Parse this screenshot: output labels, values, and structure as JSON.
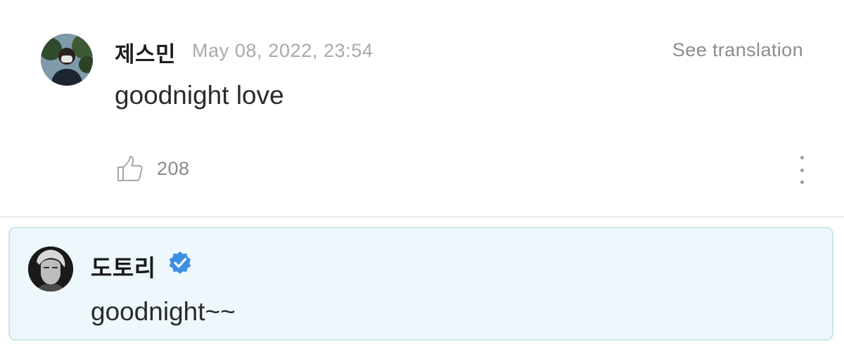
{
  "comment": {
    "author": "제스민",
    "timestamp": "May 08, 2022, 23:54",
    "translate_label": "See translation",
    "body": "goodnight love",
    "like_count": "208",
    "icons": {
      "avatar": "user-avatar",
      "like": "thumbs-up-icon",
      "more": "more-vertical-icon"
    }
  },
  "reply": {
    "author": "도토리",
    "verified": true,
    "body": "goodnight~~",
    "icons": {
      "avatar": "artist-avatar",
      "verified": "verified-badge-icon"
    }
  },
  "colors": {
    "reply_background": "#edf7fc",
    "reply_border": "#cde3ec",
    "verified_badge": "#3d8fe6",
    "timestamp_text": "#a9a9ad"
  }
}
